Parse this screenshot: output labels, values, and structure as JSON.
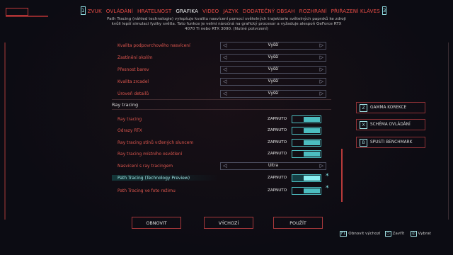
{
  "nav": {
    "left_key": "1",
    "right_key": "3",
    "tabs": [
      "ZVUK",
      "OVLÁDÁNÍ",
      "HRATELNOST",
      "GRAFIKA",
      "VIDEO",
      "JAZYK",
      "DODATEČNÝ OBSAH",
      "ROZHRANÍ",
      "PŘIŘAZENÍ KLÁVES"
    ],
    "active_tab": "GRAFIKA"
  },
  "notice": "Path Tracing (náhled technologie) vylepšuje kvalitu nasvícení pomocí světelných trajektorie světelných paprsků ke zdroji kvůli lepší simulaci fyziky světla. Tato funkce je velmi náročná na grafický procesor a vyžaduje alespoň GeForce RTX 4070 Ti nebo RTX 3090. (Nutné potvrzení)",
  "quality_settings": [
    {
      "label": "Kvalita podpovrchového nasvícení",
      "value": "Vyšší"
    },
    {
      "label": "Zastínění okolím",
      "value": "Vyšší"
    },
    {
      "label": "Přesnost barev",
      "value": "Vyšší"
    },
    {
      "label": "Kvalita zrcadel",
      "value": "Vyšší"
    },
    {
      "label": "Úroveň detailů",
      "value": "Vyšší"
    }
  ],
  "ray_tracing": {
    "title": "Ray tracing",
    "toggles": [
      {
        "label": "Ray tracing",
        "value": "ZAPNUTO"
      },
      {
        "label": "Odrazy RTX",
        "value": "ZAPNUTO"
      },
      {
        "label": "Ray tracing stínů vržených sluncem",
        "value": "ZAPNUTO"
      },
      {
        "label": "Ray tracing místního osvětlení",
        "value": "ZAPNUTO"
      }
    ],
    "lighting": {
      "label": "Nasvícení s ray tracingem",
      "value": "Ultra"
    },
    "path_tracing": {
      "label": "Path Tracing (Technology Preview)",
      "value": "ZAPNUTO"
    },
    "path_tracing_photo": {
      "label": "Path Tracing ve foto režimu",
      "value": "ZAPNUTO"
    }
  },
  "side_buttons": [
    {
      "key": "Z",
      "label": "GAMMA KOREKCE"
    },
    {
      "key": "X",
      "label": "SCHÉMA OVLÁDÁNÍ"
    },
    {
      "key": "B",
      "label": "SPUSTI BENCHMARK"
    }
  ],
  "bottom_buttons": {
    "reset": "OBNOVIT",
    "default": "VÝCHOZÍ",
    "apply": "POUŽÍT"
  },
  "hints": [
    {
      "key": "F1",
      "label": "Obnovit výchozí"
    },
    {
      "key": "○",
      "label": "Zavřít"
    },
    {
      "key": "◎",
      "label": "Vybrat"
    }
  ],
  "colors": {
    "accent_red": "#e64b45",
    "accent_cyan": "#4cbdc0",
    "highlight_cyan": "#8af0f2",
    "background": "#0c0c13"
  }
}
